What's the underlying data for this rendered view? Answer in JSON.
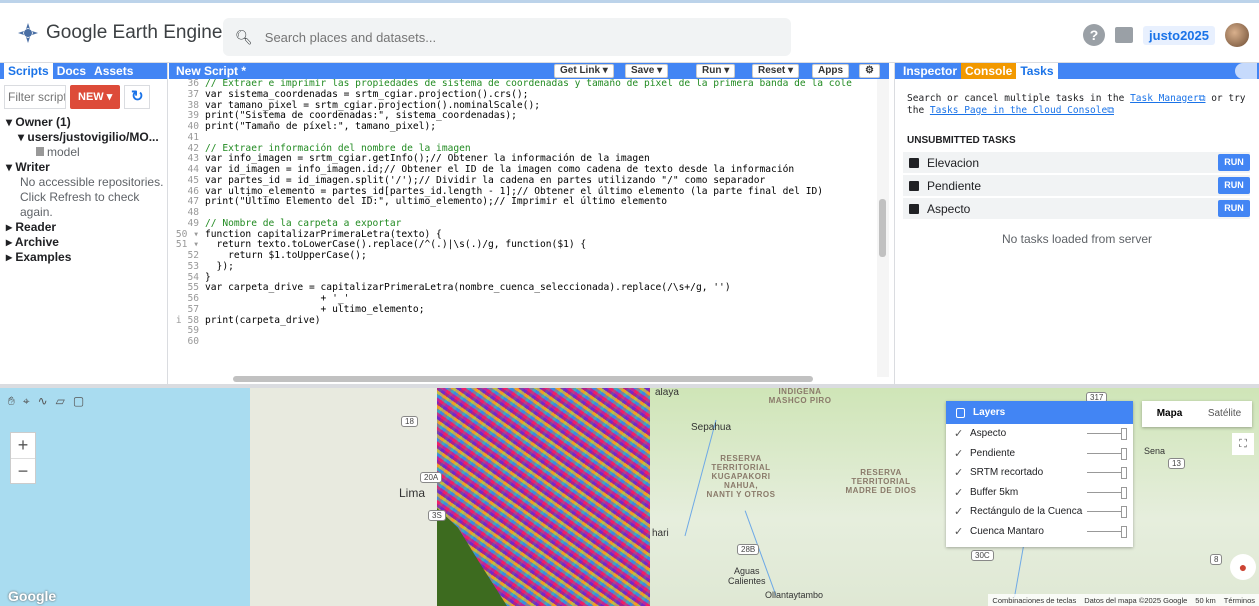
{
  "header": {
    "app_title": "Google Earth Engine",
    "search_placeholder": "Search places and datasets...",
    "help_icon_text": "?",
    "username": "justo2025"
  },
  "left_panel": {
    "tabs": [
      "Scripts",
      "Docs",
      "Assets"
    ],
    "filter_placeholder": "Filter script",
    "new_button": "NEW ▾",
    "tree": {
      "owner": "▾ Owner (1)",
      "repo": "▾ users/justovigilio/MO...",
      "script": "model",
      "writer": "▾ Writer",
      "writer_msg_1": "No accessible repositories.",
      "writer_msg_2": "Click Refresh to check",
      "writer_msg_3": "again.",
      "reader": "▸ Reader",
      "archive": "▸ Archive",
      "examples": "▸ Examples"
    }
  },
  "editor": {
    "title": "New Script *",
    "buttons": {
      "get_link": "Get Link ▾",
      "save": "Save ▾",
      "run": "Run ▾",
      "reset": "Reset ▾",
      "apps": "Apps",
      "settings": "⚙"
    },
    "lines": [
      {
        "n": "36",
        "t": "// Extraer e imprimir las propiedades de sistema de coordenadas y tamaño de píxel de la primera banda de la cole"
      },
      {
        "n": "37",
        "t": "var sistema_coordenadas = srtm_cgiar.projection().crs();"
      },
      {
        "n": "38",
        "t": "var tamano_pixel = srtm_cgiar.projection().nominalScale();"
      },
      {
        "n": "39",
        "t": "print(\"Sistema de coordenadas:\", sistema_coordenadas);"
      },
      {
        "n": "40",
        "t": "print(\"Tamaño de píxel:\", tamano_pixel);"
      },
      {
        "n": "41",
        "t": ""
      },
      {
        "n": "42",
        "t": "// Extraer información del nombre de la imagen"
      },
      {
        "n": "43",
        "t": "var info_imagen = srtm_cgiar.getInfo();// Obtener la información de la imagen"
      },
      {
        "n": "44",
        "t": "var id_imagen = info_imagen.id;// Obtener el ID de la imagen como cadena de texto desde la información"
      },
      {
        "n": "45",
        "t": "var partes_id = id_imagen.split('/');// Dividir la cadena en partes utilizando \"/\" como separador"
      },
      {
        "n": "46",
        "t": "var ultimo_elemento = partes_id[partes_id.length - 1];// Obtener el último elemento (la parte final del ID)"
      },
      {
        "n": "47",
        "t": "print(\"Último Elemento del ID:\", ultimo_elemento);// Imprimir el último elemento"
      },
      {
        "n": "48",
        "t": ""
      },
      {
        "n": "49",
        "t": "// Nombre de la carpeta a exportar"
      },
      {
        "n": "50 ▾",
        "t": "function capitalizarPrimeraLetra(texto) {"
      },
      {
        "n": "51 ▾",
        "t": "  return texto.toLowerCase().replace(/^(.)|\\s(.)/g, function($1) {"
      },
      {
        "n": "52",
        "t": "    return $1.toUpperCase();"
      },
      {
        "n": "53",
        "t": "  });"
      },
      {
        "n": "54",
        "t": "}"
      },
      {
        "n": "55",
        "t": "var carpeta_drive = capitalizarPrimeraLetra(nombre_cuenca_seleccionada).replace(/\\s+/g, '')"
      },
      {
        "n": "56",
        "t": "                    + '_'"
      },
      {
        "n": "57",
        "t": "                    + ultimo_elemento;"
      },
      {
        "n": "i 58",
        "t": "print(carpeta_drive)"
      },
      {
        "n": "59",
        "t": ""
      },
      {
        "n": "60",
        "t": ""
      }
    ]
  },
  "right_panel": {
    "tabs": [
      "Inspector",
      "Console",
      "Tasks"
    ],
    "info_prefix": "Search or cancel multiple tasks in the ",
    "task_manager_link": "Task Manager⧉",
    "info_middle": " or try the ",
    "tasks_page_link": "Tasks Page in the Cloud Console⧉",
    "unsubmitted_label": "UNSUBMITTED TASKS",
    "tasks": [
      {
        "name": "Elevacion",
        "run": "RUN"
      },
      {
        "name": "Pendiente",
        "run": "RUN"
      },
      {
        "name": "Aspecto",
        "run": "RUN"
      }
    ],
    "no_tasks": "No tasks loaded from server"
  },
  "map": {
    "layers_title": "Layers",
    "layers": [
      "Aspecto",
      "Pendiente",
      "SRTM recortado",
      "Buffer 5km",
      "Rectángulo de la Cuenca",
      "Cuenca Mantaro"
    ],
    "map_type": [
      "Mapa",
      "Satélite"
    ],
    "labels": {
      "lima": "Lima",
      "sepahua": "Sepahua",
      "aguas": "Aguas\nCalientes",
      "ollanta": "Ollantaytambo",
      "chari": "hari",
      "palaya": "alaya",
      "sena": "Sena",
      "reserva1": "RESERVA\nTERRITORIAL\nKUGAPAKORI\nNAHUA,\nNANTI Y OTROS",
      "reserva2": "RESERVA\nTERRITORIAL\nMADRE DE DIOS",
      "indigena": "INDIGENA\nMASHCO PIRO"
    },
    "shields": [
      "18",
      "20A",
      "3S",
      "28B",
      "30C",
      "317",
      "13",
      "8"
    ],
    "google": "Google",
    "attribution": [
      "Combinaciones de teclas",
      "Datos del mapa ©2025 Google",
      "50 km",
      "Términos"
    ]
  }
}
